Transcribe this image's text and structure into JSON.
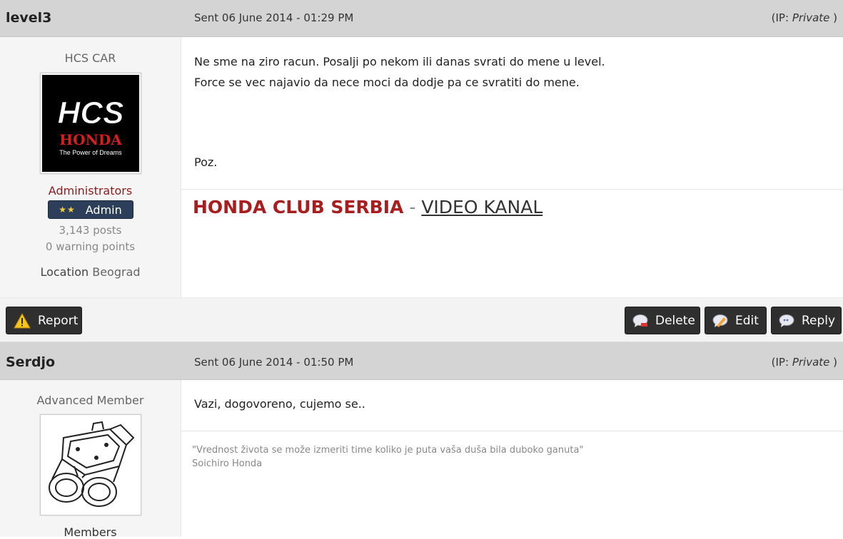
{
  "post1": {
    "author": "level3",
    "date": "Sent 06 June 2014 - 01:29 PM",
    "ip_prefix": "(IP: ",
    "ip_value": "Private",
    "ip_suffix": " )",
    "member_title": "HCS CAR",
    "avatar_text_top": "HCS",
    "avatar_text_brand": "HONDA",
    "avatar_text_slogan": "The Power of Dreams",
    "group": "Administrators",
    "badge_stars": "★★",
    "badge_label": "Admin",
    "posts": "3,143 posts",
    "warnings": "0 warning points",
    "location_label": "Location",
    "location_value": "Beograd",
    "lines": [
      "Ne sme na ziro racun. Posalji po nekom ili danas svrati do mene u level.",
      "Force se vec najavio da nece moci da dodje pa ce svratiti do mene.",
      "Poz."
    ],
    "sig_red": "HONDA CLUB SERBIA",
    "sig_dash": " - ",
    "sig_link": "VIDEO KANAL"
  },
  "controls": {
    "report": "Report",
    "delete": "Delete",
    "edit": "Edit",
    "reply": "Reply"
  },
  "post2": {
    "author": "Serdjo",
    "date": "Sent 06 June 2014 - 01:50 PM",
    "ip_prefix": "(IP: ",
    "ip_value": "Private",
    "ip_suffix": " )",
    "member_title": "Advanced Member",
    "group": "Members",
    "message": "Vazi, dogovoreno, cujemo se..",
    "sig_quote": "\"Vrednost života se može izmeriti time koliko je puta vaša duša bila duboko ganuta\"",
    "sig_author": "Soichiro Honda"
  },
  "colors": {
    "header_bg": "#d4d4d4",
    "group_red": "#8b1a1a",
    "signature_red": "#a81e1e",
    "button_bg": "#2f2f2f"
  }
}
